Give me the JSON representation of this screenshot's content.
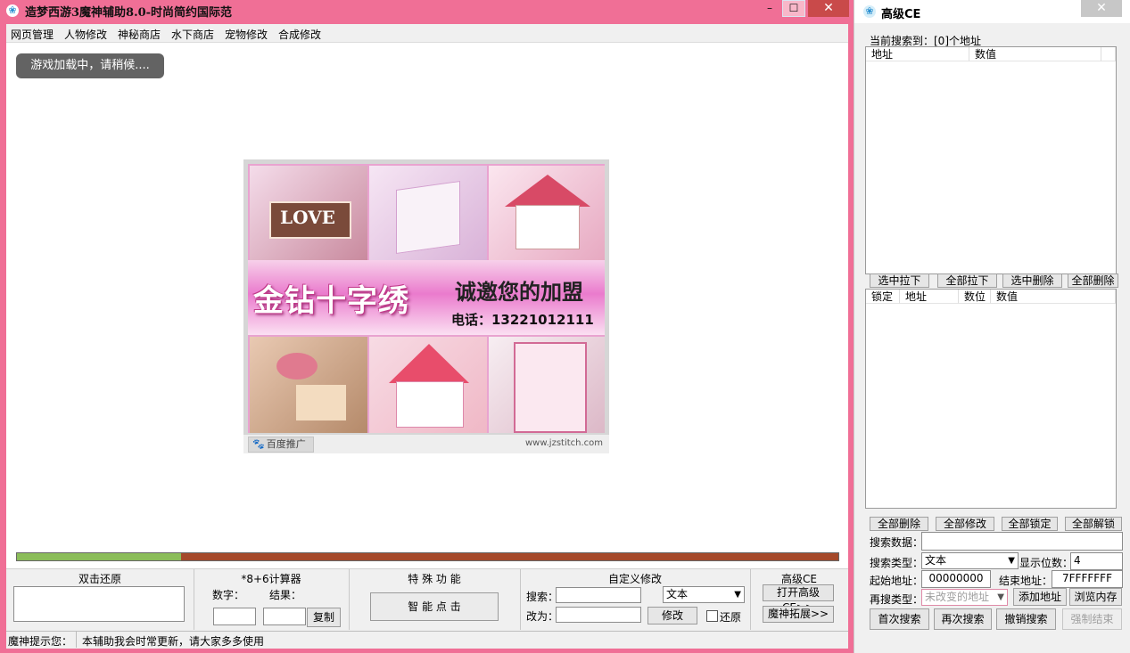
{
  "main_window": {
    "title": "造梦西游3魔神辅助8.0-时尚简约国际范",
    "min_symbol": "–",
    "max_symbol": "☐",
    "close_symbol": "✕"
  },
  "menu": [
    "网页管理",
    "人物修改",
    "神秘商店",
    "水下商店",
    "宠物修改",
    "合成修改"
  ],
  "toast": "游戏加载中，请稍候....",
  "ad": {
    "brand": "金钻十字绣",
    "invite": "诚邀您的加盟",
    "phone": "电话：13221012111",
    "tile_caption": "LOVE",
    "badge": "百度推广",
    "url": "www.jzstitch.com"
  },
  "progress": {
    "value": 0.2
  },
  "bottom": {
    "restore": {
      "title": "双击还原",
      "value": ""
    },
    "calc": {
      "title": "*8+6计算器",
      "number_label": "数字：",
      "result_label": "结果：",
      "number_value": "",
      "result_value": "",
      "copy": "复制"
    },
    "special": {
      "title": "特 殊 功 能",
      "smart_click": "智 能 点 击"
    },
    "custom": {
      "title": "自定义修改",
      "search_label": "搜索：",
      "change_label": "改为：",
      "search_value": "",
      "change_value": "",
      "type": "文本",
      "modify": "修改",
      "restore": "还原"
    },
    "advanced": {
      "title": "高级CE",
      "open_ce": "打开高级CE>>",
      "expand": "魔神拓展>>"
    }
  },
  "status": {
    "label": "魔神提示您：",
    "text": "本辅助我会时常更新，请大家多多使用"
  },
  "ce": {
    "title": "高级CE",
    "close_symbol": "✕",
    "found_text": "当前搜索到：[0]个地址",
    "list1_headers": [
      "地址",
      "数值"
    ],
    "list_buttons": [
      "选中拉下",
      "全部拉下",
      "选中删除",
      "全部删除"
    ],
    "list2_headers": [
      "锁定",
      "地址",
      "数位",
      "数值"
    ],
    "lock_buttons": [
      "全部删除",
      "全部修改",
      "全部锁定",
      "全部解锁"
    ],
    "search_data_label": "搜索数据：",
    "search_data_value": "",
    "search_type_label": "搜索类型：",
    "search_type_value": "文本",
    "digits_label": "显示位数：",
    "digits_value": "4",
    "start_label": "起始地址：",
    "start_value": "00000000",
    "end_label": "结束地址：",
    "end_value": "7FFFFFFF",
    "research_label": "再搜类型：",
    "research_value": "未改变的地址",
    "add_address": "添加地址",
    "browse_memory": "浏览内存",
    "first_search": "首次搜索",
    "next_search": "再次搜索",
    "undo_search": "撤销搜索",
    "force_end": "强制结束"
  }
}
